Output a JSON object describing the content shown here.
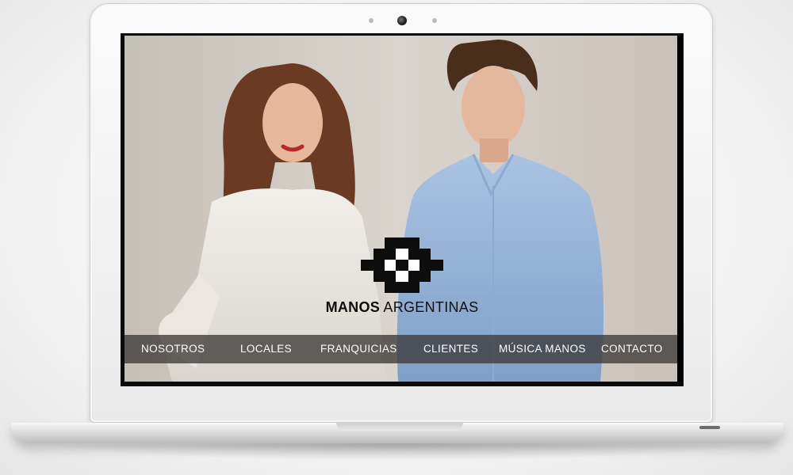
{
  "brand": {
    "name_bold": "MANOS",
    "name_light": "ARGENTINAS"
  },
  "nav": {
    "items": [
      {
        "label": "NOSOTROS"
      },
      {
        "label": "LOCALES"
      },
      {
        "label": "FRANQUICIAS"
      },
      {
        "label": "CLIENTES"
      },
      {
        "label": "MÚSICA MANOS"
      },
      {
        "label": "CONTACTO"
      }
    ]
  },
  "icons": {
    "logo": "manos-argentinas-logo-icon",
    "camera": "webcam-icon"
  },
  "colors": {
    "nav_background": "#3c3a39",
    "nav_text": "#ffffff",
    "logo": "#0d0d0d",
    "laptop_silver": "#e9e9e9"
  }
}
